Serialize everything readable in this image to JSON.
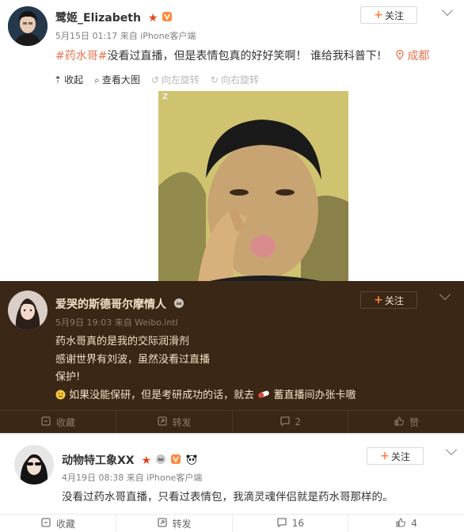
{
  "post1": {
    "username": "鹭姬_Elizabeth",
    "meta": "5月15日 01:17 来自 iPhone客户端",
    "follow_label": "关注",
    "hashtag": "#药水哥#",
    "text": "没看过直播，但是表情包真的好好笑啊！ 谁给我科普下!",
    "location": "成都",
    "media_bar": {
      "collapse": "收起",
      "view_large": "查看大图",
      "rotate_left": "向左旋转",
      "rotate_right": "向右旋转"
    },
    "meme_label": "Z"
  },
  "post2": {
    "username": "爱哭的斯德哥尔摩情人",
    "meta": "5月9日 19:03 来自 Weibo.intl",
    "follow_label": "关注",
    "lines": [
      "药水哥真的是我的交际润滑剂",
      "感谢世界有刘波，虽然没看过直播",
      "保护!",
      "如果没能保研，但是考研成功的话，就去",
      "蓄直播间办张卡嗷"
    ],
    "actions": {
      "collect": "收藏",
      "repost": "转发",
      "comments": "2",
      "like": "赞"
    }
  },
  "post3": {
    "username": "动物特工象XX",
    "meta": "4月19日 08:38 来自 iPhone客户端",
    "follow_label": "关注",
    "text": "没看过药水哥直播，只看过表情包，我滴灵魂伴侣就是药水哥那样的。",
    "actions": {
      "collect": "收藏",
      "repost": "转发",
      "comments": "16",
      "likes": "4"
    }
  },
  "colors": {
    "accent": "#eb7350",
    "dark_bg": "#3b2716",
    "dark_text": "#f2e0c6"
  }
}
